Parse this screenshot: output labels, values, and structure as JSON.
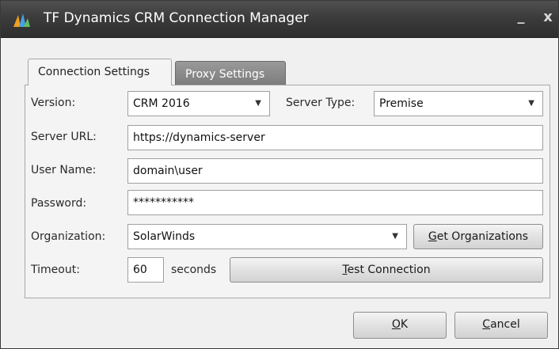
{
  "window": {
    "title": "TF Dynamics CRM Connection Manager",
    "minimize": "_",
    "close": "x"
  },
  "tabs": {
    "connection": "Connection Settings",
    "proxy": "Proxy Settings"
  },
  "form": {
    "version_label": "Version:",
    "version_value": "CRM 2016",
    "server_type_label": "Server Type:",
    "server_type_value": "Premise",
    "server_url_label": "Server URL:",
    "server_url_value": "https://dynamics-server",
    "user_name_label": "User Name:",
    "user_name_value": "domain\\user",
    "password_label": "Password:",
    "password_value": "***********",
    "organization_label": "Organization:",
    "organization_value": "SolarWinds",
    "get_org_key": "G",
    "get_org_rest": "et Organizations",
    "timeout_label": "Timeout:",
    "timeout_value": "60",
    "timeout_unit": "seconds",
    "test_key": "T",
    "test_rest": "est Connection"
  },
  "footer": {
    "ok_key": "O",
    "ok_rest": "K",
    "cancel_key": "C",
    "cancel_rest": "ancel"
  },
  "icons": {
    "app": "app-logo-icon",
    "dropdown": "chevron-down-icon"
  },
  "colors": {
    "titlebar": "#3c3c3c",
    "tab_inactive": "#8a8a8a"
  }
}
